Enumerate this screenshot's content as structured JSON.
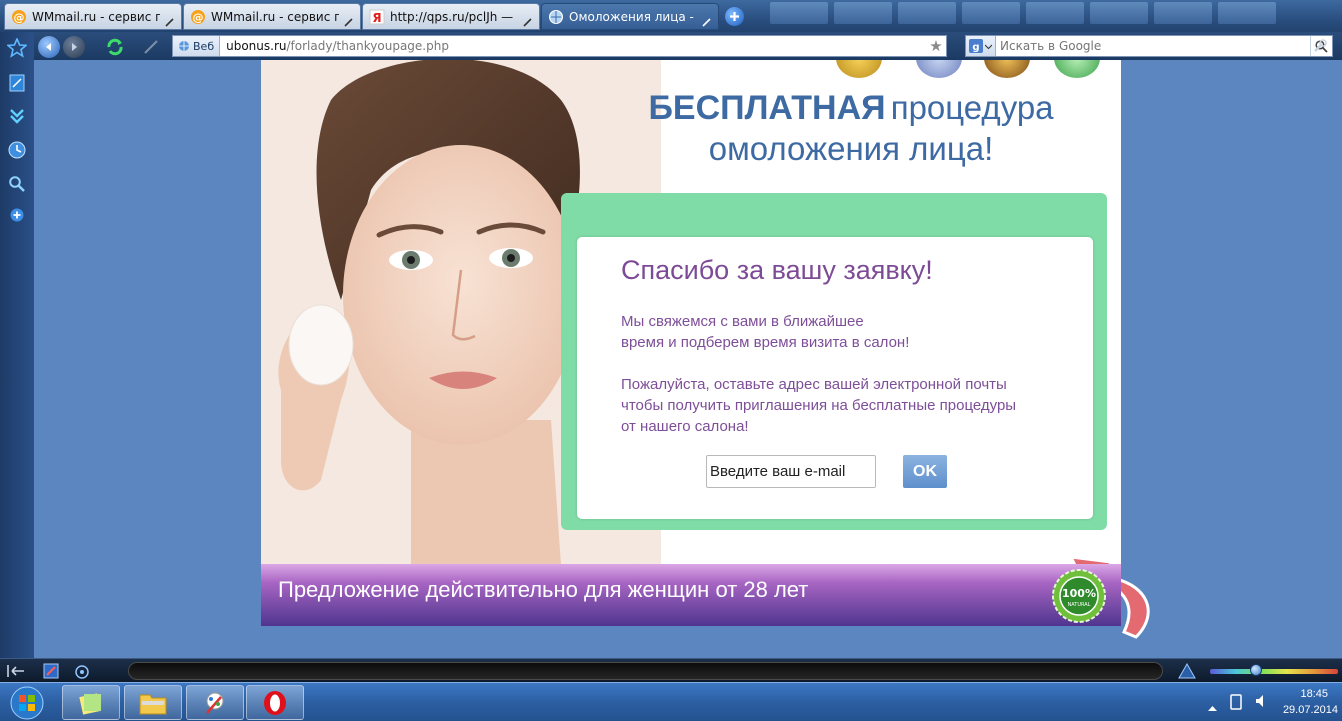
{
  "browser": {
    "tabs": [
      {
        "label": "WMmail.ru - сервис п...",
        "icon": "at-sign-icon",
        "active": false
      },
      {
        "label": "WMmail.ru - сервис п...",
        "icon": "at-sign-icon",
        "active": false
      },
      {
        "label": "http://qps.ru/pclJh — ...",
        "icon": "yandex-icon",
        "active": false
      },
      {
        "label": "Омоложения лица - ...",
        "icon": "globe-icon",
        "active": true
      }
    ],
    "address": {
      "badge": "Веб",
      "host": "ubonus.ru",
      "path": "/forlady/thankyoupage.php"
    },
    "search": {
      "placeholder": "Искать в Google",
      "engine_icon": "google-icon"
    }
  },
  "landing": {
    "headline_strong": "БЕСПЛАТНАЯ",
    "headline_rest": "процедура",
    "headline_line2": "омоложения лица!",
    "card": {
      "title": "Спасибо за вашу заявку!",
      "line1": "Мы свяжемся с вами в ближайшее",
      "line2": "время и подберем время визита в салон!",
      "line3": "Пожалуйста, оставьте адрес вашей электронной почты",
      "line4": "чтобы получить приглашения на бесплатные процедуры",
      "line5": "от нашего салона!",
      "email_placeholder": "Введите ваш e-mail",
      "ok_label": "OK"
    },
    "offer": "Предложение действительно для женщин от 28 лет",
    "badge_text": "100%",
    "badge_sub": "NATURAL"
  },
  "taskbar": {
    "time": "18:45",
    "date": "29.07.2014"
  },
  "colors": {
    "headline": "#3e6aa3",
    "card_text": "#7e4f98",
    "green_frame": "#80dca7",
    "ok_button": "#5e8fcc"
  }
}
